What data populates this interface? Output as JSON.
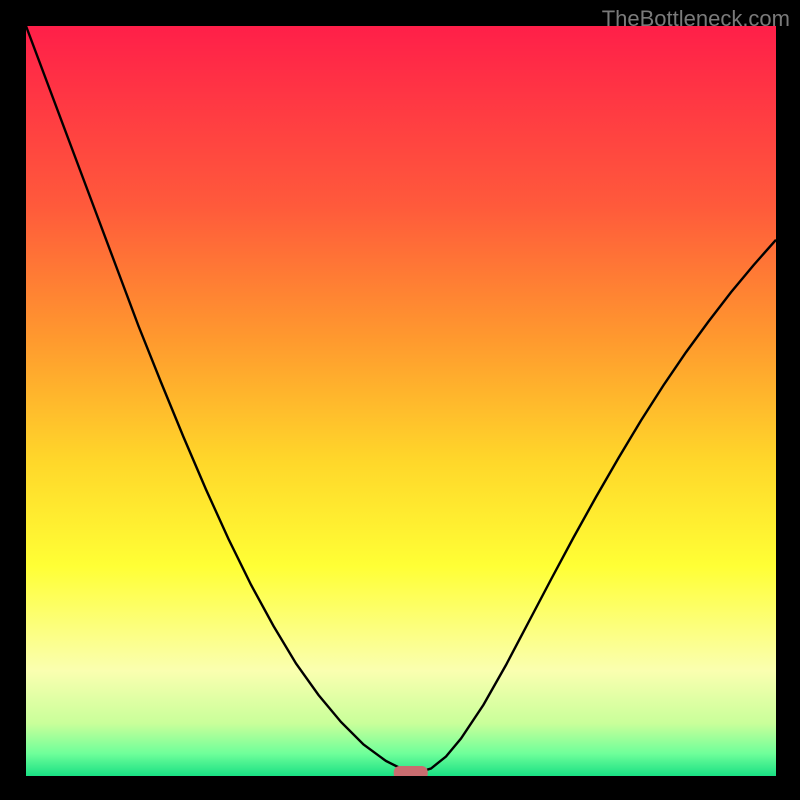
{
  "watermark": "TheBottleneck.com",
  "chart_data": {
    "type": "line",
    "title": "",
    "xlabel": "",
    "ylabel": "",
    "xlim": [
      0,
      1
    ],
    "ylim": [
      0,
      1
    ],
    "grid": false,
    "legend": false,
    "background_gradient": {
      "stops": [
        {
          "pos": 0.0,
          "color": "#ff1f49"
        },
        {
          "pos": 0.24,
          "color": "#ff5a3b"
        },
        {
          "pos": 0.42,
          "color": "#ff9a2e"
        },
        {
          "pos": 0.58,
          "color": "#ffd72a"
        },
        {
          "pos": 0.72,
          "color": "#ffff35"
        },
        {
          "pos": 0.86,
          "color": "#faffb0"
        },
        {
          "pos": 0.93,
          "color": "#c9ff9a"
        },
        {
          "pos": 0.97,
          "color": "#6fff9a"
        },
        {
          "pos": 1.0,
          "color": "#19e084"
        }
      ]
    },
    "series": [
      {
        "name": "bottleneck-curve",
        "color": "#000000",
        "x": [
          0.0,
          0.03,
          0.06,
          0.09,
          0.12,
          0.15,
          0.18,
          0.21,
          0.24,
          0.27,
          0.3,
          0.33,
          0.36,
          0.39,
          0.42,
          0.45,
          0.48,
          0.5,
          0.51,
          0.52,
          0.54,
          0.56,
          0.58,
          0.61,
          0.64,
          0.67,
          0.7,
          0.73,
          0.76,
          0.79,
          0.82,
          0.85,
          0.88,
          0.91,
          0.94,
          0.97,
          1.0
        ],
        "y": [
          1.0,
          0.92,
          0.84,
          0.76,
          0.68,
          0.6,
          0.525,
          0.452,
          0.382,
          0.316,
          0.255,
          0.2,
          0.15,
          0.108,
          0.072,
          0.042,
          0.02,
          0.01,
          0.006,
          0.004,
          0.01,
          0.026,
          0.05,
          0.095,
          0.148,
          0.205,
          0.262,
          0.318,
          0.372,
          0.424,
          0.474,
          0.521,
          0.565,
          0.606,
          0.645,
          0.681,
          0.715
        ]
      }
    ],
    "marker": {
      "name": "min-point",
      "x": 0.513,
      "y": 0.0,
      "shape": "rounded-rect",
      "color": "#c96c6f"
    }
  }
}
